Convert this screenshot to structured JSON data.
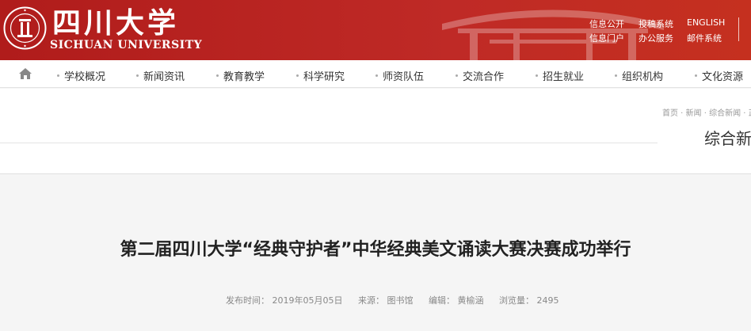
{
  "header": {
    "logo_cn": "四川大学",
    "logo_en": "SICHUAN UNIVERSITY",
    "links": [
      "信息公开",
      "投稿系统",
      "ENGLISH",
      "信息门户",
      "办公服务",
      "邮件系统"
    ]
  },
  "nav": {
    "items": [
      "学校概况",
      "新闻资讯",
      "教育教学",
      "科学研究",
      "师资队伍",
      "交流合作",
      "招生就业",
      "组织机构",
      "文化资源"
    ]
  },
  "breadcrumb": "首页 · 新闻 · 综合新闻 · 正",
  "section_title": "综合新",
  "article": {
    "title": "第二届四川大学“经典守护者”中华经典美文诵读大赛决赛成功举行",
    "meta": {
      "date": "发布时间： 2019年05月05日",
      "source": "来源： 图书馆",
      "editor": "编辑： 黄榆涵",
      "views": "浏览量： 2495"
    }
  },
  "colors": {
    "brand_red": "#b01c1b",
    "text_dark": "#222222",
    "text_muted": "#888888"
  }
}
